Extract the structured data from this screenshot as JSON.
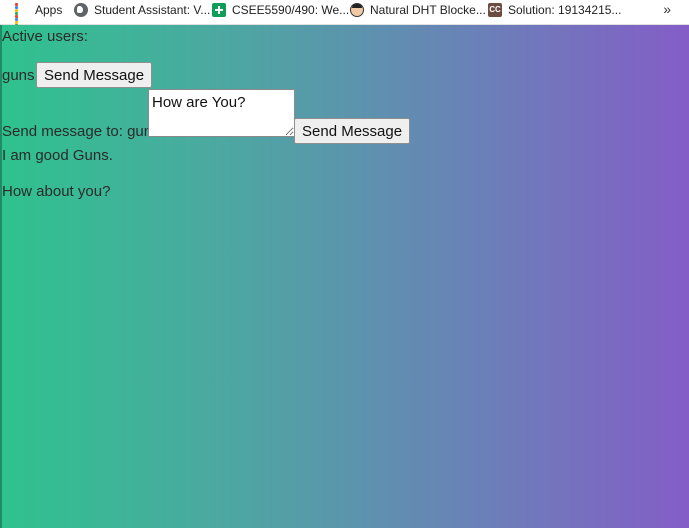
{
  "bookmarks": {
    "items": [
      {
        "label": "Apps",
        "icon": "apps-grid-icon"
      },
      {
        "label": "Student Assistant: V...",
        "icon": "globe-icon"
      },
      {
        "label": "CSEE5590/490: We...",
        "icon": "google-sheets-icon"
      },
      {
        "label": "Natural DHT Blocke...",
        "icon": "avatar-face-icon"
      },
      {
        "label": "Solution: 19134215...",
        "icon": "cc-icon"
      }
    ],
    "more": "»"
  },
  "page": {
    "active_users_label": "Active users:",
    "users": [
      {
        "name": "guns",
        "button_label": "Send Message"
      }
    ],
    "compose": {
      "label": "Send message to: guns",
      "message_value": "How are You?",
      "send_button_label": "Send Message"
    },
    "messages": [
      "I am good Guns.",
      "How about you?"
    ]
  },
  "colors": {
    "gradient_start": "#2fc28e",
    "gradient_end": "#845dc7"
  }
}
